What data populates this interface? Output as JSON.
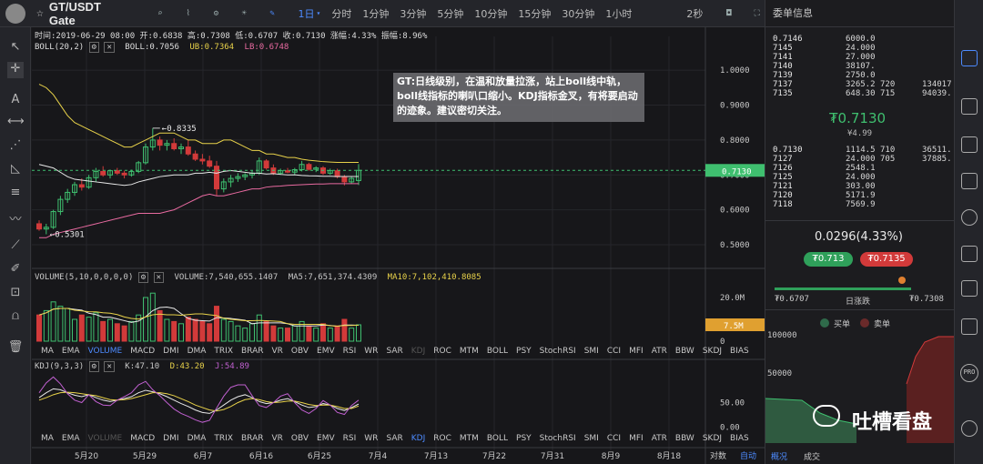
{
  "header": {
    "symbol": "GT/USDT Gate",
    "intervals": [
      "1日",
      "分时",
      "1分钟",
      "3分钟",
      "5分钟",
      "10分钟",
      "15分钟",
      "30分钟",
      "1小时"
    ],
    "active_interval": "1日",
    "countdown": "2秒"
  },
  "ohlc_line": "时间:2019-06-29 08:00  开:0.6838  高:0.7308  低:0.6707  收:0.7130  涨幅:4.33%  振幅:8.96%",
  "boll": {
    "name": "BOLL(20,2)",
    "boll": "BOLL:0.7056",
    "ub": "UB:0.7364",
    "lb": "LB:0.6748"
  },
  "volume_legend": {
    "name": "VOLUME(5,10,0,0,0,0)",
    "vol": "VOLUME:7,540,655.1407",
    "ma5": "MA5:7,651,374.4309",
    "ma10": "MA10:7,102,410.8085"
  },
  "kdj_legend": {
    "name": "KDJ(9,3,3)",
    "k": "K:47.10",
    "d": "D:43.20",
    "j": "J:54.89"
  },
  "price_axis": [
    "1.0000",
    "0.9000",
    "0.8000",
    "0.7000",
    "0.6000",
    "0.5000"
  ],
  "current_price_tag": "0.7130",
  "high_label": "0.8335",
  "low_label": "0.5301",
  "vol_axis": [
    "20.0M",
    "10.0M",
    "0"
  ],
  "vol_tag": "7.5M",
  "kdj_axis": [
    "50.00",
    "0.00"
  ],
  "indicators": [
    "MA",
    "EMA",
    "VOLUME",
    "MACD",
    "DMI",
    "DMA",
    "TRIX",
    "BRAR",
    "VR",
    "OBV",
    "EMV",
    "RSI",
    "WR",
    "SAR",
    "KDJ",
    "ROC",
    "MTM",
    "BOLL",
    "PSY",
    "StochRSI",
    "SMI",
    "CCI",
    "MFI",
    "ATR",
    "BBW",
    "SKDJ",
    "BIAS"
  ],
  "x_dates": [
    "5月20",
    "5月29",
    "6月7",
    "6月16",
    "6月25",
    "7月4",
    "7月13",
    "7月22",
    "7月31",
    "8月9",
    "8月18"
  ],
  "bottom_tabs": [
    "对数",
    "自动"
  ],
  "annotation": "GT:日线级别，在温和放量拉涨，站上boll线中轨，boll线指标的喇叭口缩小。KDJ指标金叉，有将要启动的迹象。建议密切关注。",
  "right_panel": {
    "title": "委单信息",
    "asks": [
      [
        "0.7146",
        "6000.0",
        "",
        ""
      ],
      [
        "7145",
        "24.000",
        "",
        ""
      ],
      [
        "7141",
        "27.000",
        "",
        ""
      ],
      [
        "7140",
        "38107.",
        "",
        ""
      ],
      [
        "7139",
        "2750.0",
        "",
        ""
      ],
      [
        "7137",
        "3265.2",
        "720",
        "134017"
      ],
      [
        "7135",
        "648.30",
        "715",
        "94039."
      ]
    ],
    "last_price": "₮0.7130",
    "last_sub": "¥4.99",
    "bids": [
      [
        "0.7130",
        "1114.5",
        "710",
        "36511."
      ],
      [
        "7127",
        "24.000",
        "705",
        "37885."
      ],
      [
        "7126",
        "2548.1",
        "",
        ""
      ],
      [
        "7125",
        "24.000",
        "",
        ""
      ],
      [
        "7121",
        "303.00",
        "",
        ""
      ],
      [
        "7120",
        "5171.9",
        "",
        ""
      ],
      [
        "7118",
        "7569.9",
        "",
        ""
      ]
    ],
    "change": "0.0296(4.33%)",
    "pill_low": "₮0.713",
    "pill_high": "₮0.7135",
    "range_low": "₮0.6707",
    "range_label": "日涨跌",
    "range_high": "₮0.7308",
    "depth_legend_buy": "买单",
    "depth_legend_sell": "卖单",
    "depth_axis": [
      "100000",
      "50000"
    ],
    "tabs": [
      "概况",
      "成交"
    ]
  },
  "watermark": "吐槽看盘"
}
